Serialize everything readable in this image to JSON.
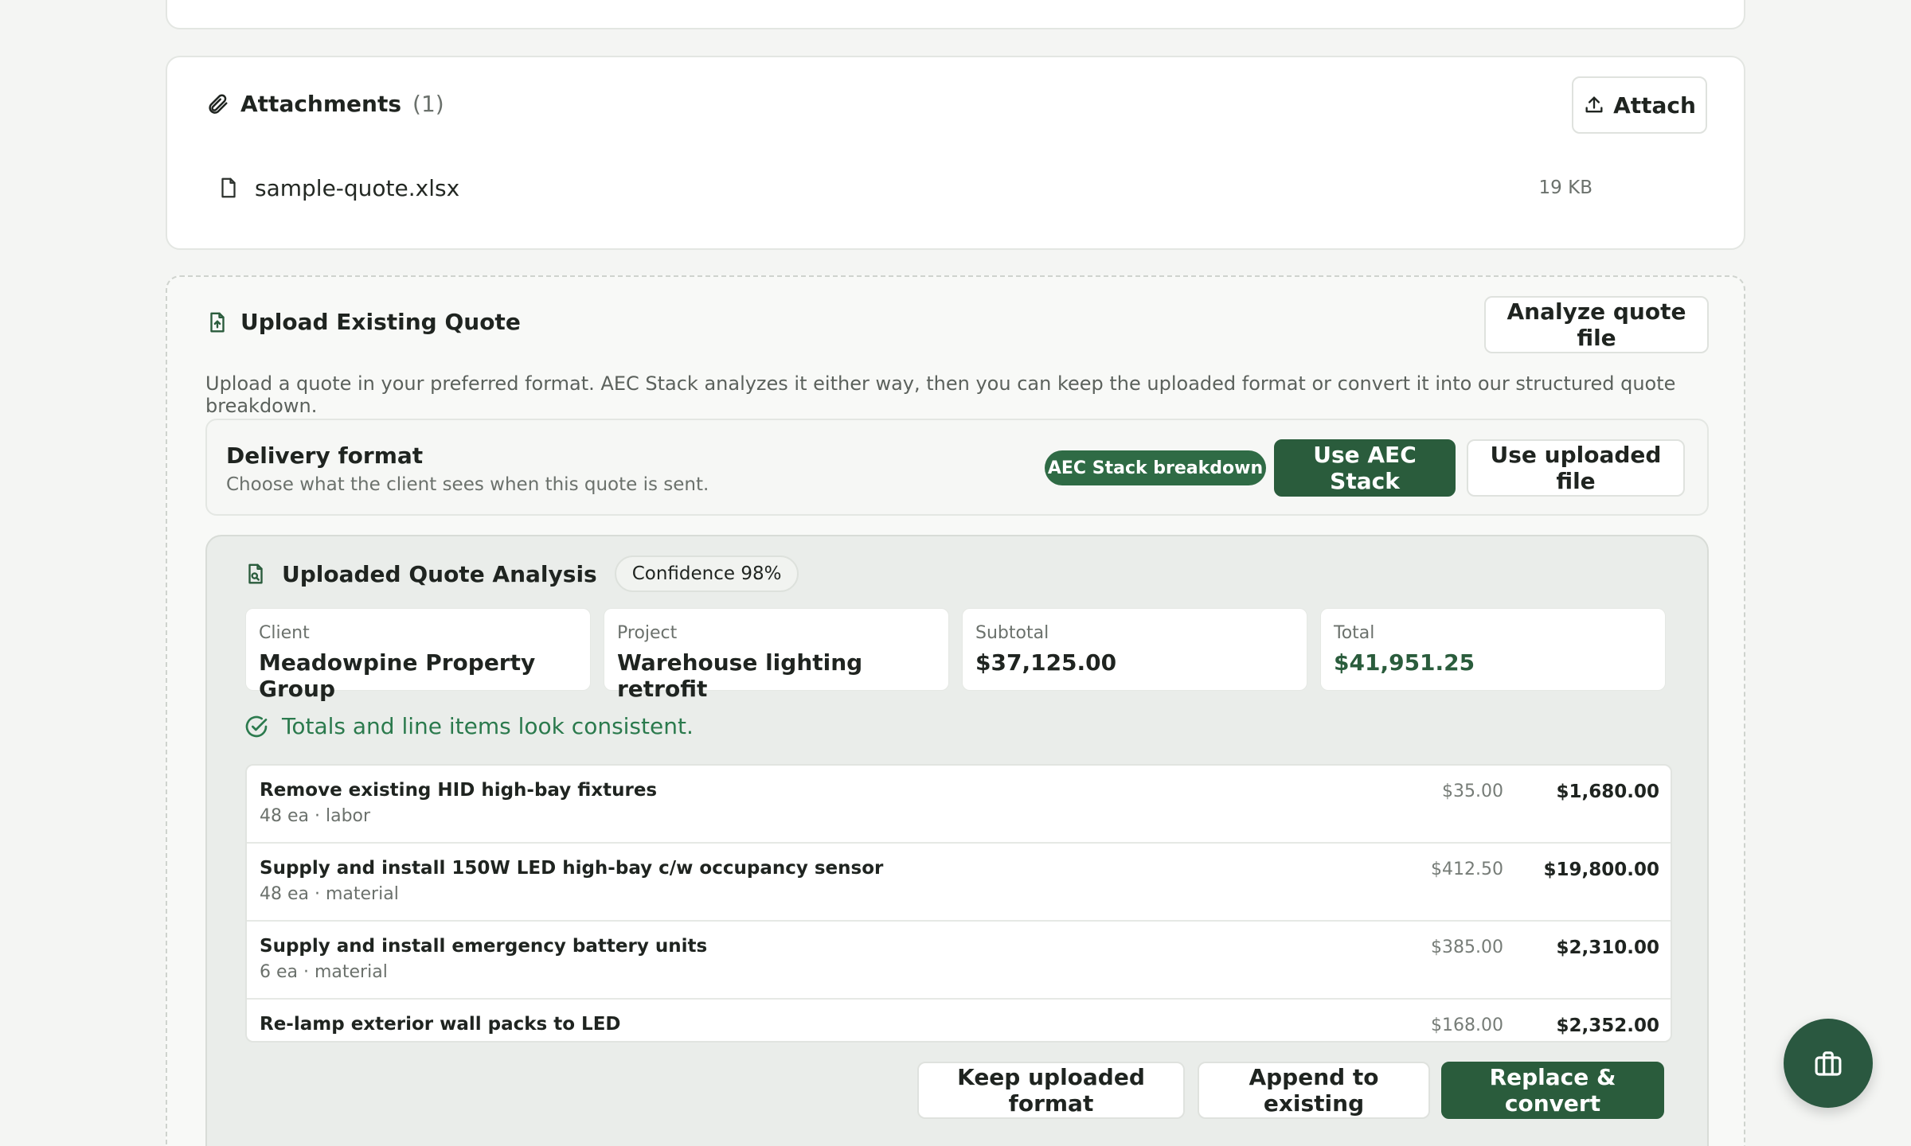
{
  "attachments": {
    "title": "Attachments",
    "count": "(1)",
    "attach_label": "Attach",
    "files": [
      {
        "name": "sample-quote.xlsx",
        "size": "19 KB"
      }
    ]
  },
  "upload": {
    "title": "Upload Existing Quote",
    "analyze_label": "Analyze quote file",
    "description": "Upload a quote in your preferred format. AEC Stack analyzes it either way, then you can keep the uploaded format or convert it into our structured quote breakdown.",
    "delivery": {
      "title": "Delivery format",
      "subtitle": "Choose what the client sees when this quote is sent.",
      "badge": "AEC Stack breakdown",
      "use_aec_label": "Use AEC Stack",
      "use_uploaded_label": "Use uploaded file"
    },
    "analysis": {
      "title": "Uploaded Quote Analysis",
      "confidence": "Confidence 98%",
      "stats": [
        {
          "label": "Client",
          "value": "Meadowpine Property Group"
        },
        {
          "label": "Project",
          "value": "Warehouse lighting retrofit"
        },
        {
          "label": "Subtotal",
          "value": "$37,125.00"
        },
        {
          "label": "Total",
          "value": "$41,951.25"
        }
      ],
      "consistency_message": "Totals and line items look consistent.",
      "line_items": [
        {
          "description": "Remove existing HID high-bay fixtures",
          "meta": "48 ea · labor",
          "unit_price": "$35.00",
          "amount": "$1,680.00"
        },
        {
          "description": "Supply and install 150W LED high-bay c/w occupancy sensor",
          "meta": "48 ea · material",
          "unit_price": "$412.50",
          "amount": "$19,800.00"
        },
        {
          "description": "Supply and install emergency battery units",
          "meta": "6 ea · material",
          "unit_price": "$385.00",
          "amount": "$2,310.00"
        },
        {
          "description": "Re-lamp exterior wall packs to LED",
          "meta": "",
          "unit_price": "$168.00",
          "amount": "$2,352.00"
        }
      ],
      "actions": {
        "keep_label": "Keep uploaded format",
        "append_label": "Append to existing",
        "replace_label": "Replace & convert"
      }
    }
  },
  "fab": {
    "icon": "gift-icon"
  },
  "colors": {
    "brand": "#2a5c3c",
    "success": "#2b7a4d"
  }
}
